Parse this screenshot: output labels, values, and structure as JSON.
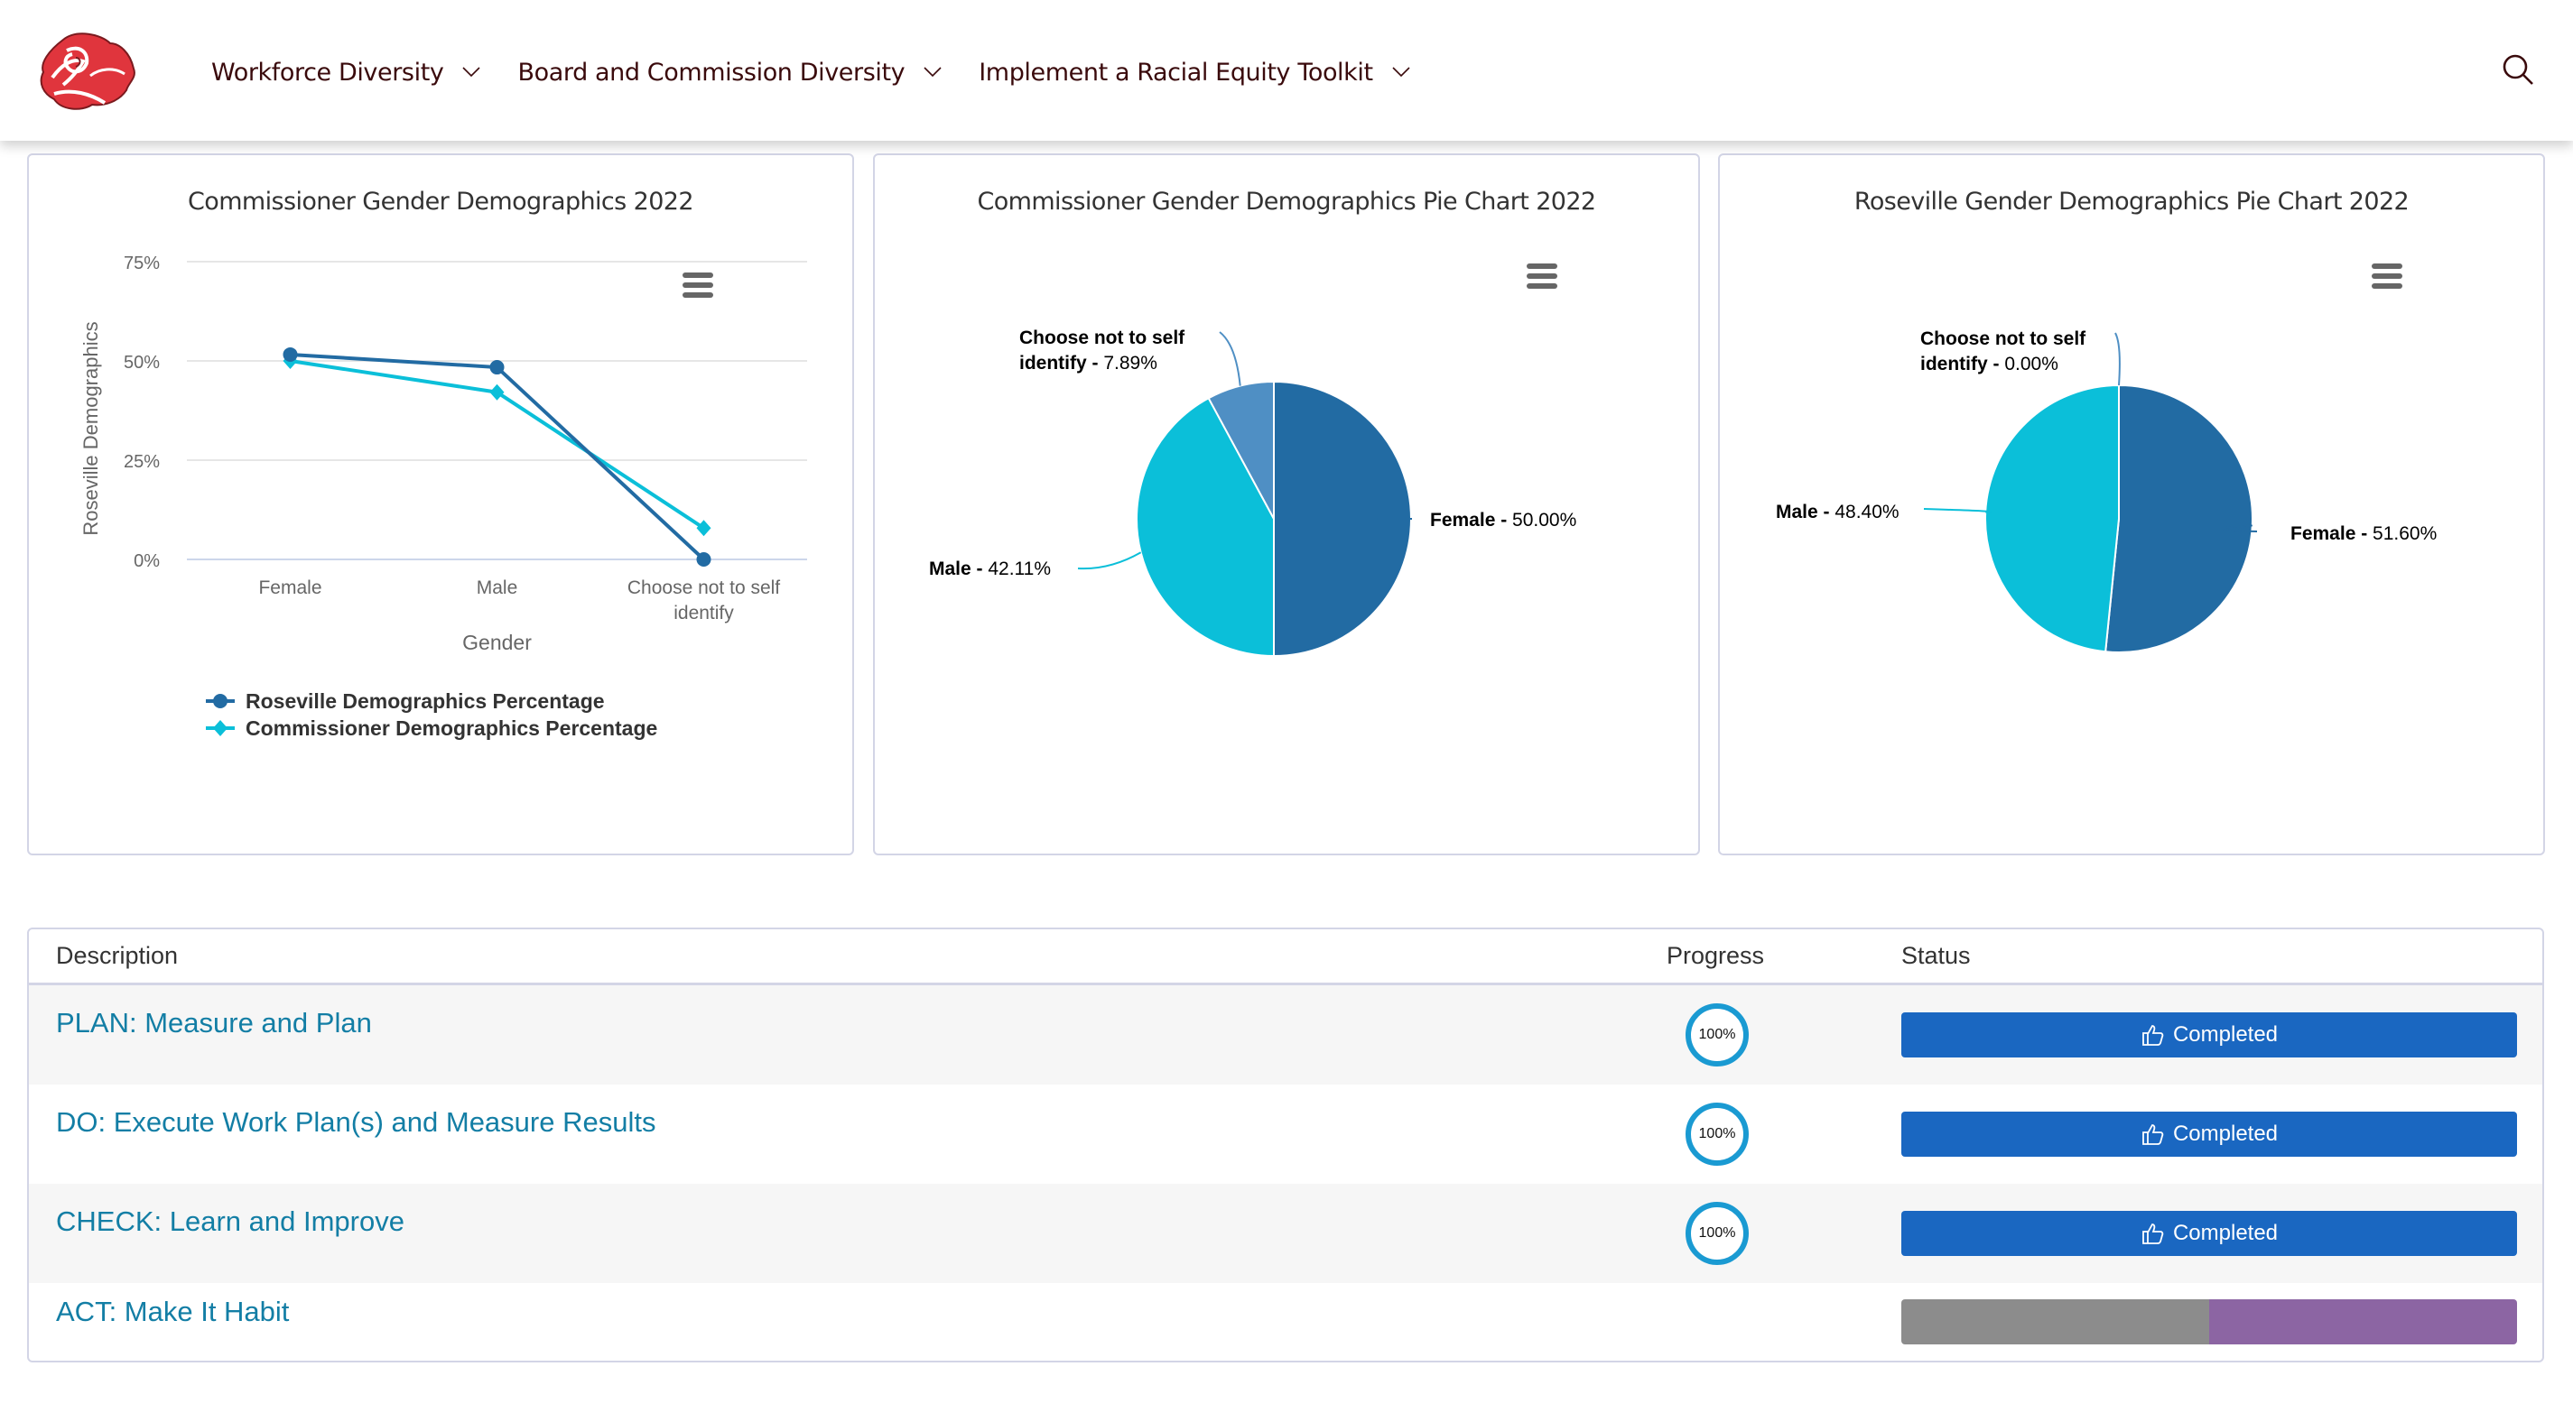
{
  "header": {
    "logo_icon": "rose-logo-icon",
    "nav": [
      {
        "label": "Workforce Diversity",
        "icon": "chevron-down-icon"
      },
      {
        "label": "Board and Commission Diversity",
        "icon": "chevron-down-icon"
      },
      {
        "label": "Implement a Racial Equity Toolkit",
        "icon": "chevron-down-icon"
      }
    ],
    "search_icon": "search-icon",
    "text_color": "#3a0a0c"
  },
  "colors": {
    "roseville": "#226ba3",
    "commissioner": "#0bbfd9",
    "decline_slice": "#4f8fc4",
    "link": "#137ea5",
    "status_completed": "#1a67c1",
    "progress_ring": "#1a9ad2",
    "bar_gray": "#8c8c8c",
    "bar_purple": "#8c65a3"
  },
  "chart_data": [
    {
      "type": "line",
      "title": "Commissioner Gender Demographics 2022",
      "xlabel": "Gender",
      "ylabel": "Roseville Demographics",
      "categories": [
        "Female",
        "Male",
        "Choose not to self identify"
      ],
      "category_lines": [
        [
          "Female"
        ],
        [
          "Male"
        ],
        [
          "Choose not to self",
          "identify"
        ]
      ],
      "yticks": [
        "0%",
        "25%",
        "50%",
        "75%"
      ],
      "ytick_values": [
        0,
        25,
        50,
        75
      ],
      "ylim": [
        0,
        75
      ],
      "grid": true,
      "legend_position": "bottom-left",
      "series": [
        {
          "name": "Roseville Demographics Percentage",
          "values": [
            51.6,
            48.4,
            0.0
          ],
          "marker": "circle",
          "color": "#226ba3"
        },
        {
          "name": "Commissioner Demographics Percentage",
          "values": [
            50.0,
            42.11,
            7.89
          ],
          "marker": "diamond",
          "color": "#0bbfd9"
        }
      ]
    },
    {
      "type": "pie",
      "title": "Commissioner Gender Demographics Pie Chart 2022",
      "slices": [
        {
          "label": "Female",
          "value": 50.0,
          "display": "50.00%",
          "color": "#226ba3"
        },
        {
          "label": "Male",
          "value": 42.11,
          "display": "42.11%",
          "color": "#0bbfd9"
        },
        {
          "label": "Choose not to self identify",
          "value": 7.89,
          "display": "7.89%",
          "color": "#4f8fc4"
        }
      ]
    },
    {
      "type": "pie",
      "title": "Roseville Gender Demographics Pie Chart 2022",
      "slices": [
        {
          "label": "Female",
          "value": 51.6,
          "display": "51.60%",
          "color": "#226ba3"
        },
        {
          "label": "Male",
          "value": 48.4,
          "display": "48.40%",
          "color": "#0bbfd9"
        },
        {
          "label": "Choose not to self identify",
          "value": 0.0,
          "display": "0.00%",
          "color": "#4f8fc4"
        }
      ]
    }
  ],
  "table": {
    "columns": [
      "Description",
      "Progress",
      "Status"
    ],
    "rows": [
      {
        "description": "PLAN: Measure and Plan",
        "progress": "100%",
        "progress_value": 100,
        "status": "Completed",
        "status_icon": "thumbs-up-icon"
      },
      {
        "description": "DO: Execute Work Plan(s) and Measure Results",
        "progress": "100%",
        "progress_value": 100,
        "status": "Completed",
        "status_icon": "thumbs-up-icon"
      },
      {
        "description": "CHECK: Learn and Improve",
        "progress": "100%",
        "progress_value": 100,
        "status": "Completed",
        "status_icon": "thumbs-up-icon"
      },
      {
        "description": "ACT: Make It Habit",
        "progress": "",
        "status": "",
        "status_bar_split": [
          0.5,
          0.5
        ]
      }
    ]
  }
}
